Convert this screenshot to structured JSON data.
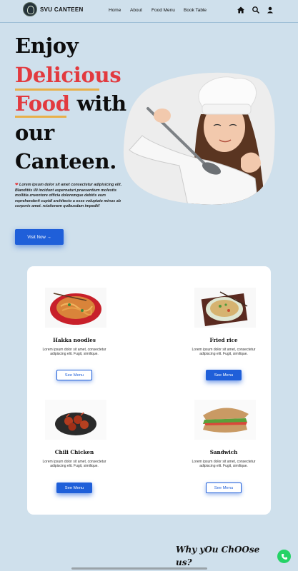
{
  "nav": {
    "brand": "SVU CANTEEN",
    "links": [
      "Home",
      "About",
      "Food Menu",
      "Book Table"
    ],
    "icons": [
      "home-icon",
      "search-icon",
      "user-icon"
    ]
  },
  "hero": {
    "line1": "Enjoy",
    "line2": "Delicious",
    "line3_red": "Food",
    "line3_rest": " with",
    "line4": "our",
    "line5": "Canteen.",
    "text": "Lorem ipsum dolor sit amet consectetur adipisicing elit. Blanditiis illi incidunt aspernaturi praesentium molestis mollitia znventore officia doloremque debitis eum reprehenderit cupidi architecto a esse voluptate minus ab corporis amet. rciationem quibusdam impedit!",
    "button": "Visit Now →",
    "accent_red": "#e23a3f",
    "accent_blue": "#1f5fd9"
  },
  "menu": {
    "items": [
      {
        "name": "Hakka noodles",
        "desc": "Lorem ipsum dolor sit amet, consectetur adipiscing elit. Fugit, similique.",
        "button": "See Menu"
      },
      {
        "name": "Fried rice",
        "desc": "Lorem ipsum dolor sit amet, consectetur adipiscing elit. Fugit, similique.",
        "button": "See Menu"
      },
      {
        "name": "Chili Chicken",
        "desc": "Lorem ipsum dolor sit amet, consectetur adipiscing elit. Fugit, similique.",
        "button": "See Menu"
      },
      {
        "name": "Sandwich",
        "desc": "Lorem ipsum dolor sit amet, consectetur adipiscing elit. Fugit, similique.",
        "button": "See Menu"
      }
    ]
  },
  "why": {
    "line1": "Why yOu ChOOse",
    "line2": "us?"
  }
}
